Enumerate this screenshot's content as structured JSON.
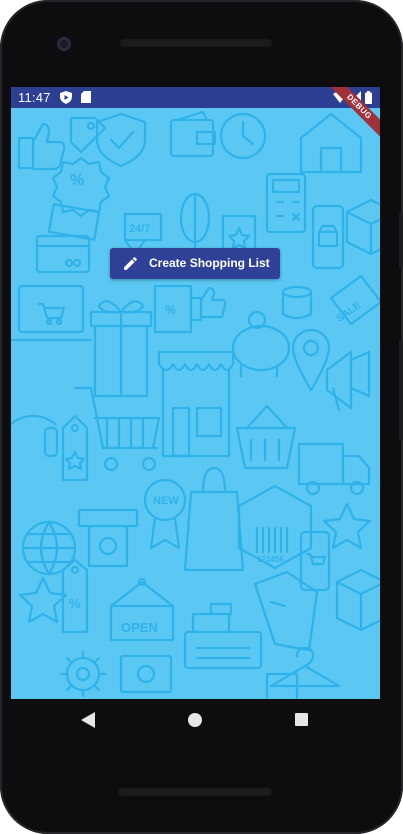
{
  "status_bar": {
    "time": "11:47",
    "icons": [
      "shield-app-icon",
      "sd-card-icon",
      "wifi-icon",
      "signal-icon",
      "battery-icon"
    ]
  },
  "debug_banner": "DEBUG",
  "main": {
    "create_button": {
      "label": "Create Shopping List",
      "icon": "pencil-icon"
    },
    "background_labels": [
      "%",
      "24/7",
      "%",
      "NEW",
      "SALE",
      "OPEN",
      "123456",
      "%"
    ]
  },
  "nav_bar": {
    "back": "back-triangle-icon",
    "home": "home-circle-icon",
    "recents": "recents-square-icon"
  },
  "colors": {
    "screen_bg": "#5ac8f2",
    "pattern_stroke": "#2fb2ea",
    "status_bar": "#2c3f92",
    "button": "#2e4196",
    "debug_banner": "#9f3138",
    "phone_body": "#0d0d0f"
  }
}
